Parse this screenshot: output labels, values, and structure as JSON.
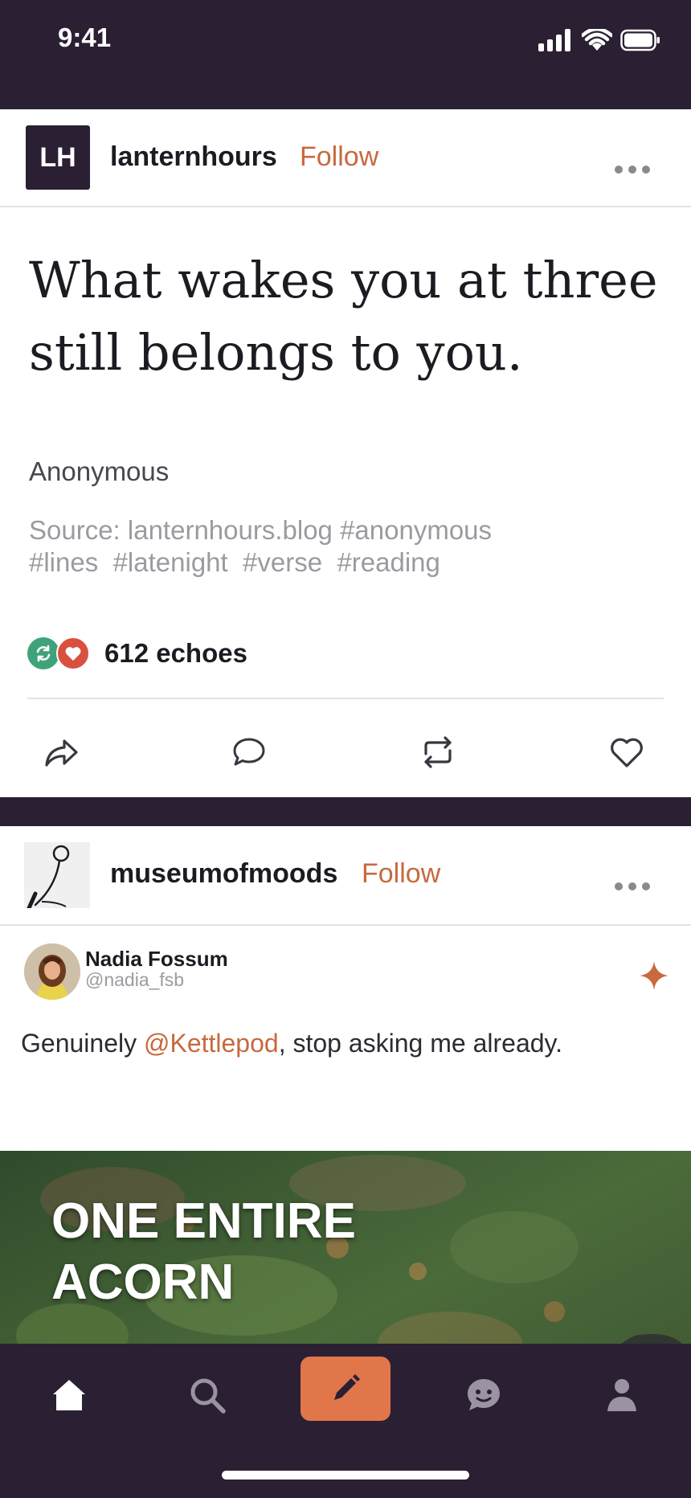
{
  "status_bar": {
    "time": "9:41"
  },
  "post1": {
    "author": {
      "initials": "LH",
      "username": "lanternhours",
      "follow_label": "Follow"
    },
    "quote_lines": [
      "What wakes you at three",
      "still belongs to you."
    ],
    "attribution": "Anonymous",
    "source": "Source: lanternhours.blog",
    "tags": [
      "#anonymous",
      "#lines",
      "#latenight",
      "#verse",
      "#reading"
    ],
    "notes_count": "612 echoes",
    "actions": [
      "share-icon",
      "comment-icon",
      "reblog-icon",
      "heart-icon"
    ]
  },
  "post2": {
    "author": {
      "username": "museumofmoods",
      "follow_label": "Follow"
    },
    "tweet": {
      "name": "Nadia Fossum",
      "handle": "@nadia_fsb",
      "text_before": "Genuinely ",
      "mention": "@Kettlepod",
      "text_after": ", stop asking me already."
    },
    "hero_lines": [
      "ONE ENTIRE",
      "ACORN"
    ]
  },
  "tab_bar": {
    "tabs": [
      "home-icon",
      "search-icon",
      "compose-icon",
      "chat-icon",
      "profile-icon"
    ],
    "accent_color": "#e0764a"
  },
  "colors": {
    "background": "#2a1f33",
    "accent": "#c8693e",
    "reblog_green": "#3fa37a",
    "like_red": "#d9503f"
  }
}
